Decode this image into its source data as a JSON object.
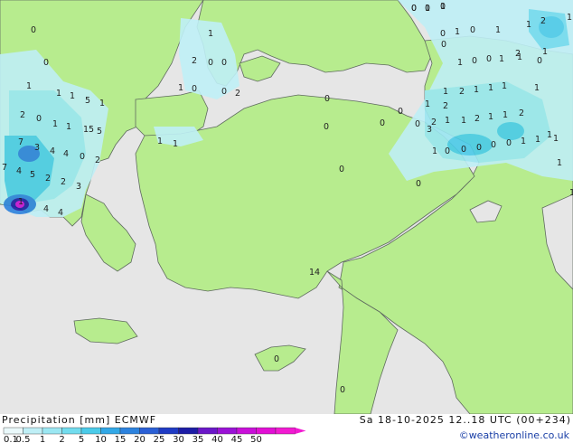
{
  "colors": {
    "sea": "#e6e6e6",
    "land": "#b7ec8e",
    "border": "#5f6b5f",
    "legend": [
      "#eaf9fb",
      "#bfeff6",
      "#9be7f2",
      "#72dcee",
      "#4bcbe9",
      "#32a8e6",
      "#2c82de",
      "#2a5fd5",
      "#1f3bc4",
      "#1c1ca5",
      "#6a17c8",
      "#9a12d6",
      "#c90fd9",
      "#e20fd5",
      "#f21ad2"
    ]
  },
  "footer": {
    "title": "Precipitation [mm]  ECMWF",
    "date": "Sa 18-10-2025 12..18 UTC (00+234)",
    "credit": "©weatheronline.co.uk",
    "legend_ticks": [
      "0.1",
      "0.5",
      "1",
      "2",
      "5",
      "10",
      "15",
      "20",
      "25",
      "30",
      "35",
      "40",
      "45",
      "50"
    ]
  },
  "map_labels": [
    "0",
    "1",
    "0",
    "0",
    "1",
    "0",
    "2",
    "0",
    "0",
    "1",
    "1",
    "0",
    "0",
    "2",
    "1",
    "1",
    "2",
    "1",
    "1",
    "0",
    "0",
    "1",
    "1",
    "0",
    "0",
    "1",
    "2",
    "1",
    "2",
    "1",
    "1",
    "1",
    "1",
    "1",
    "1",
    "2",
    "1",
    "1",
    "2",
    "2",
    "1",
    "1",
    "5",
    "1",
    "0",
    "1",
    "1",
    "15",
    "5",
    "2",
    "7",
    "3",
    "4",
    "4",
    "0",
    "2",
    "4",
    "5",
    "2",
    "2",
    "3",
    "7",
    "1",
    "4",
    "4",
    "0",
    "0",
    "1",
    "1",
    "0",
    "2",
    "1",
    "0",
    "0",
    "0",
    "0",
    "0",
    "1",
    "1",
    "1",
    "1",
    "1",
    "0",
    "1",
    "1",
    "14",
    "0",
    "0",
    "3",
    "0",
    "0",
    "0",
    "1",
    "0",
    "0",
    "0",
    "0",
    "1"
  ]
}
